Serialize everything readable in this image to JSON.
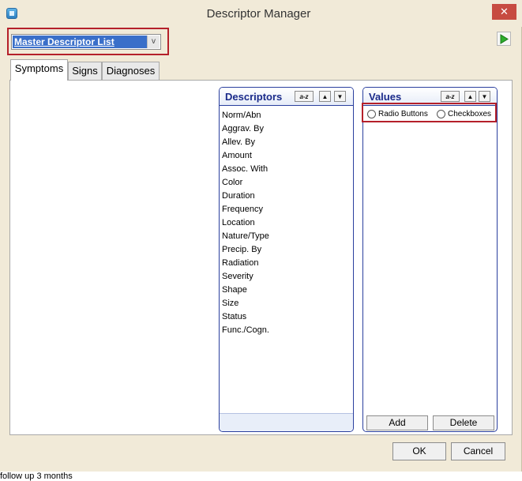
{
  "window": {
    "title": "Descriptor Manager",
    "close_glyph": "✕",
    "icon": "app-icon"
  },
  "toolbar": {
    "list_select": "Master Descriptor List",
    "dropdown_arrow": "v",
    "play_icon": "play-icon"
  },
  "tabs": [
    {
      "label": "Symptoms",
      "active": true
    },
    {
      "label": "Signs",
      "active": false
    },
    {
      "label": "Diagnoses",
      "active": false
    }
  ],
  "descriptors": {
    "title": "Descriptors",
    "sort_label": "a-z",
    "up_glyph": "▲",
    "down_glyph": "▼",
    "items": [
      "Norm/Abn",
      "Aggrav. By",
      "Allev. By",
      "Amount",
      "Assoc. With",
      "Color",
      "Duration",
      "Frequency",
      "Location",
      "Nature/Type",
      "Precip. By",
      "Radiation",
      "Severity",
      "Shape",
      "Size",
      "Status",
      "Func./Cogn."
    ]
  },
  "values": {
    "title": "Values",
    "sort_label": "a-z",
    "up_glyph": "▲",
    "down_glyph": "▼",
    "radio_buttons_label": "Radio Buttons",
    "checkboxes_label": "Checkboxes",
    "add_label": "Add",
    "delete_label": "Delete"
  },
  "footer": {
    "ok_label": "OK",
    "cancel_label": "Cancel"
  },
  "background_text": "follow up 3 months",
  "colors": {
    "accent": "#3a6fc9",
    "highlight_box": "#b5202a",
    "panel_border": "#2a3f9e",
    "close": "#c74b41"
  }
}
